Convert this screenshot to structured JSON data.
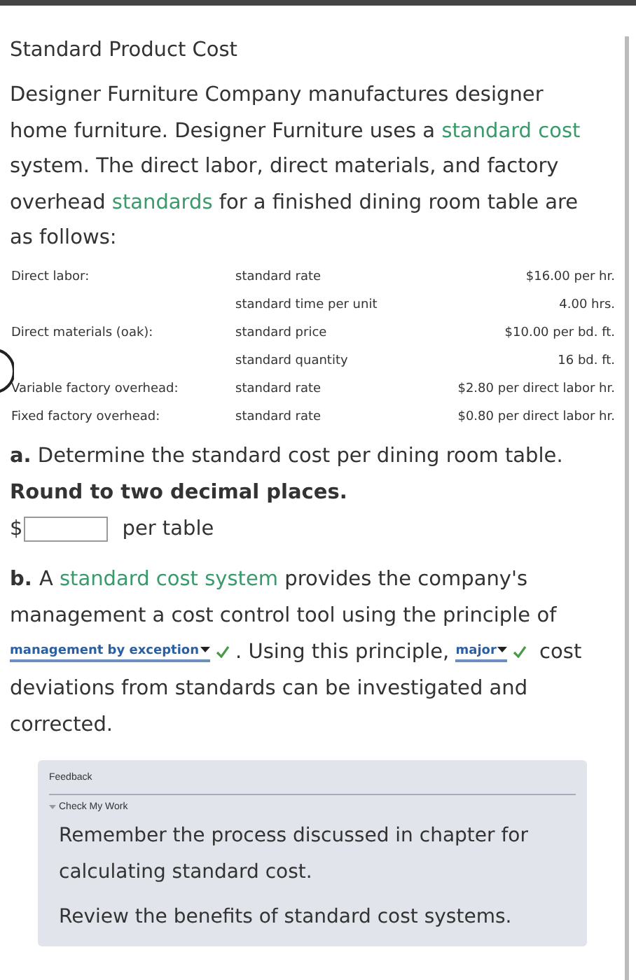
{
  "title": "Standard Product Cost",
  "intro": [
    {
      "kind": "text",
      "text": "Designer Furniture Company manufactures designer home furniture. Designer Furniture uses a "
    },
    {
      "kind": "link",
      "text": "standard cost"
    },
    {
      "kind": "text",
      "text": " system. The direct labor, direct materials, and factory overhead "
    },
    {
      "kind": "link",
      "text": "standards"
    },
    {
      "kind": "text",
      "text": " for a finished dining room table are as follows:"
    }
  ],
  "table": {
    "rows": [
      {
        "item": "Direct labor:",
        "measure": "standard rate",
        "value": "$16.00 per hr."
      },
      {
        "item": "",
        "measure": "standard time per unit",
        "value": "4.00 hrs."
      },
      {
        "item": "Direct materials (oak):",
        "measure": "standard price",
        "value": "$10.00 per bd. ft."
      },
      {
        "item": "",
        "measure": "standard quantity",
        "value": "16 bd. ft."
      },
      {
        "item": "Variable factory overhead:",
        "measure": "standard rate",
        "value": "$2.80 per direct labor hr."
      },
      {
        "item": "Fixed factory overhead:",
        "measure": "standard rate",
        "value": "$0.80 per direct labor hr."
      }
    ]
  },
  "part_a": {
    "label": "a.",
    "question": "Determine the standard cost per dining room table.",
    "instruction": "Round to two decimal places.",
    "prefix": "$",
    "suffix": "per table"
  },
  "part_b": {
    "label": "b.",
    "segments": [
      {
        "kind": "text",
        "text": "A "
      },
      {
        "kind": "link",
        "text": "standard cost system"
      },
      {
        "kind": "text",
        "text": " provides the company's management a cost control tool using the principle of "
      },
      {
        "kind": "dropdown",
        "text": "management by exception",
        "correct": true
      },
      {
        "kind": "text",
        "text": ". Using this principle, "
      },
      {
        "kind": "dropdown",
        "text": "major",
        "correct": true
      },
      {
        "kind": "text",
        "text": " cost deviations from standards can be investigated and corrected."
      }
    ]
  },
  "feedback": {
    "heading": "Feedback",
    "toggle": "Check My Work",
    "expanded": true,
    "paragraphs": [
      "Remember the process discussed in chapter for calculating standard cost.",
      "Review the benefits of standard cost systems."
    ]
  }
}
